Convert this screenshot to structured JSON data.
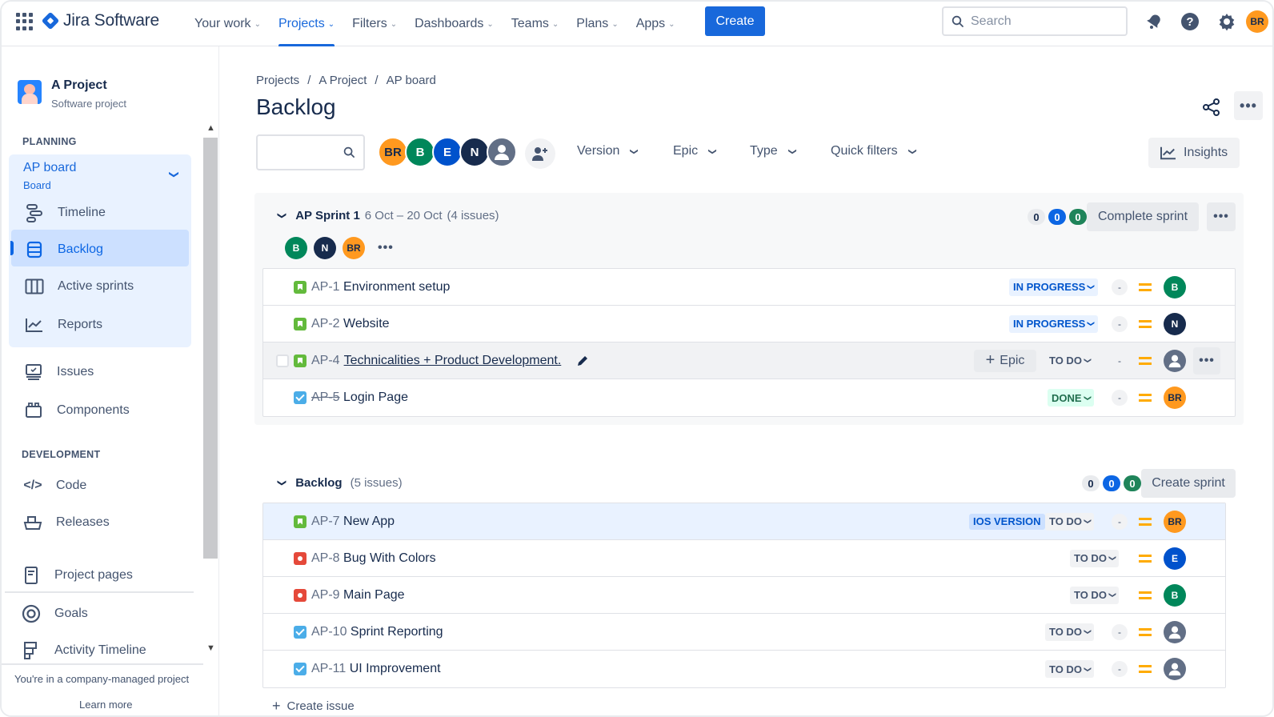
{
  "topnav": {
    "product": "Jira Software",
    "items": [
      {
        "label": "Your work",
        "active": false
      },
      {
        "label": "Projects",
        "active": true
      },
      {
        "label": "Filters",
        "active": false
      },
      {
        "label": "Dashboards",
        "active": false
      },
      {
        "label": "Teams",
        "active": false
      },
      {
        "label": "Plans",
        "active": false
      },
      {
        "label": "Apps",
        "active": false
      }
    ],
    "create_label": "Create",
    "search_placeholder": "Search",
    "user_initials": "BR",
    "icons": [
      "app-switcher-icon",
      "notifications-icon",
      "help-icon",
      "settings-icon"
    ]
  },
  "sidebar": {
    "project_name": "A Project",
    "project_type": "Software project",
    "planning_label": "PLANNING",
    "board": {
      "title": "AP board",
      "subtitle": "Board"
    },
    "planning_items": [
      {
        "label": "Timeline",
        "icon": "timeline-icon"
      },
      {
        "label": "Backlog",
        "icon": "backlog-icon",
        "active": true
      },
      {
        "label": "Active sprints",
        "icon": "columns-icon"
      },
      {
        "label": "Reports",
        "icon": "reports-icon"
      }
    ],
    "other_items": [
      {
        "label": "Issues",
        "icon": "issues-icon"
      },
      {
        "label": "Components",
        "icon": "components-icon"
      }
    ],
    "development_label": "DEVELOPMENT",
    "development_items": [
      {
        "label": "Code",
        "icon": "code-icon"
      },
      {
        "label": "Releases",
        "icon": "releases-icon"
      }
    ],
    "extra_items": [
      {
        "label": "Project pages",
        "icon": "page-icon"
      },
      {
        "label": "Goals",
        "icon": "goals-icon"
      },
      {
        "label": "Activity Timeline",
        "icon": "activity-timeline-icon"
      }
    ],
    "footer_message": "You're in a company-managed project",
    "footer_link": "Learn more"
  },
  "main": {
    "breadcrumb": [
      "Projects",
      "A Project",
      "AP board"
    ],
    "title": "Backlog",
    "search_placeholder": "",
    "avatars": [
      {
        "initials": "BR",
        "color": "orange"
      },
      {
        "initials": "B",
        "color": "green"
      },
      {
        "initials": "E",
        "color": "blue"
      },
      {
        "initials": "N",
        "color": "navy"
      },
      {
        "initials": "",
        "color": "gray"
      }
    ],
    "filters": [
      "Version",
      "Epic",
      "Type",
      "Quick filters"
    ],
    "insights_label": "Insights"
  },
  "sprint": {
    "name": "AP Sprint 1",
    "dates": "6 Oct – 20 Oct",
    "issue_count": "(4 issues)",
    "counts": {
      "todo": "0",
      "in_progress": "0",
      "done": "0"
    },
    "assignees": [
      "B",
      "N",
      "BR"
    ],
    "complete_label": "Complete sprint",
    "issues": [
      {
        "key": "AP-1",
        "summary": "Environment setup",
        "type": "story",
        "status": "IN PROGRESS",
        "points": "-",
        "assignee": "B"
      },
      {
        "key": "AP-2",
        "summary": "Website",
        "type": "story",
        "status": "IN PROGRESS",
        "points": "-",
        "assignee": "N"
      },
      {
        "key": "AP-4",
        "summary": "Technicalities + Product Development.",
        "type": "story",
        "status": "TO DO",
        "points": "-",
        "assignee": "",
        "epic_label": "Epic"
      },
      {
        "key": "AP-5",
        "summary": "Login Page",
        "type": "task",
        "status": "DONE",
        "points": "-",
        "assignee": "BR"
      }
    ]
  },
  "backlog": {
    "name": "Backlog",
    "issue_count": "(5 issues)",
    "counts": {
      "todo": "0",
      "in_progress": "0",
      "done": "0"
    },
    "create_sprint_label": "Create sprint",
    "create_issue_label": "Create issue",
    "issues": [
      {
        "key": "AP-7",
        "summary": "New App",
        "type": "story",
        "status": "TO DO",
        "points": "-",
        "assignee": "BR",
        "version": "IOS VERSION"
      },
      {
        "key": "AP-8",
        "summary": "Bug With Colors",
        "type": "bug",
        "status": "TO DO",
        "assignee": "E"
      },
      {
        "key": "AP-9",
        "summary": "Main Page",
        "type": "bug",
        "status": "TO DO",
        "assignee": "B"
      },
      {
        "key": "AP-10",
        "summary": "Sprint Reporting",
        "type": "task",
        "status": "TO DO",
        "points": "-",
        "assignee": ""
      },
      {
        "key": "AP-11",
        "summary": "UI Improvement",
        "type": "task",
        "status": "TO DO",
        "points": "-",
        "assignee": ""
      }
    ]
  }
}
